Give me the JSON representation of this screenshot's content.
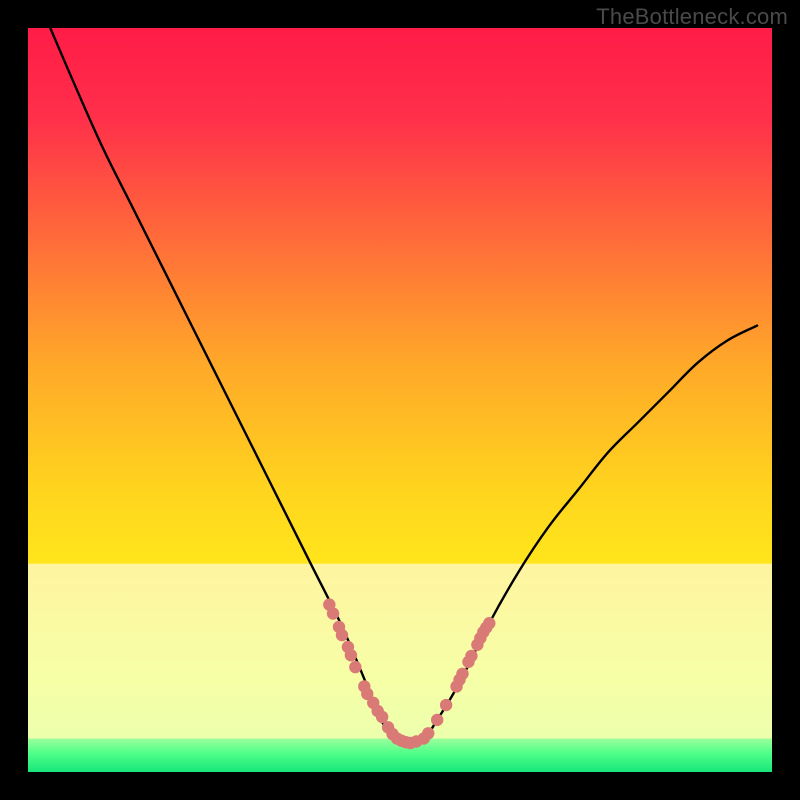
{
  "watermark": "TheBottleneck.com",
  "chart_data": {
    "type": "line",
    "title": "",
    "xlabel": "",
    "ylabel": "",
    "xlim": [
      0,
      100
    ],
    "ylim": [
      0,
      100
    ],
    "series": [
      {
        "name": "bottleneck-curve",
        "x": [
          3,
          6,
          10,
          14,
          18,
          22,
          26,
          30,
          34,
          38,
          42,
          45,
          47,
          49,
          51,
          53,
          55,
          58,
          62,
          66,
          70,
          74,
          78,
          82,
          86,
          90,
          94,
          98
        ],
        "y": [
          100,
          93,
          84,
          76,
          68,
          60,
          52,
          44,
          36,
          28,
          20,
          13,
          8,
          4.5,
          3.8,
          4.2,
          7,
          12,
          20,
          27,
          33,
          38,
          43,
          47,
          51,
          55,
          58,
          60
        ]
      }
    ],
    "markers": {
      "name": "highlight-dots",
      "x": [
        40.5,
        41.8,
        43.0,
        44.0,
        45.2,
        46.4,
        47.6,
        49.0,
        50.2,
        51.4,
        53.2,
        55.0,
        56.2,
        57.6,
        58.4,
        59.2,
        60.4,
        61.2,
        62.0,
        41.0,
        42.2,
        43.4,
        45.6,
        47.0,
        48.4,
        49.6,
        50.8,
        52.2,
        53.8,
        58.0,
        59.6,
        60.8,
        61.6
      ],
      "y": [
        22.5,
        19.5,
        16.8,
        14.1,
        11.5,
        9.3,
        7.4,
        5.1,
        4.2,
        3.9,
        4.5,
        7.0,
        9.0,
        11.5,
        13.2,
        14.8,
        17.1,
        18.8,
        20.0,
        21.3,
        18.4,
        15.7,
        10.5,
        8.2,
        6.0,
        4.5,
        4.0,
        4.1,
        5.2,
        12.4,
        15.6,
        18.0,
        19.4
      ]
    },
    "gradient_bands": {
      "pale_yellow_top_y": 28,
      "green_band_top_y": 4.5
    }
  }
}
